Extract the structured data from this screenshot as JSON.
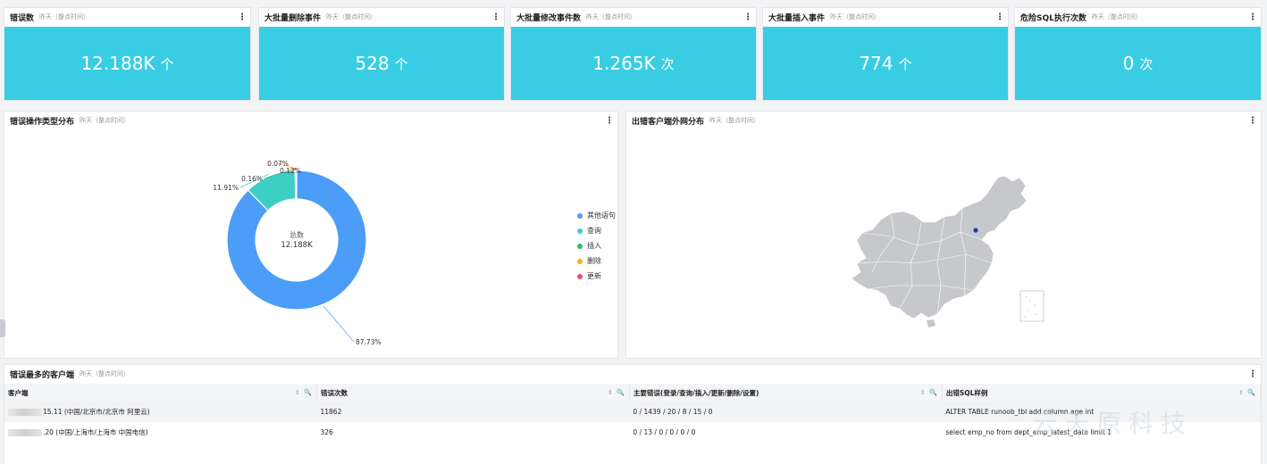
{
  "metrics": [
    {
      "title": "错误数",
      "subtitle": "昨天（整点时间）",
      "value": "12.188K",
      "unit": "个"
    },
    {
      "title": "大批量删除事件",
      "subtitle": "昨天（整点时间）",
      "value": "528",
      "unit": "个"
    },
    {
      "title": "大批量修改事件数",
      "subtitle": "昨天（整点时间）",
      "value": "1.265K",
      "unit": "次"
    },
    {
      "title": "大批量插入事件",
      "subtitle": "昨天（整点时间）",
      "value": "774",
      "unit": "个"
    },
    {
      "title": "危险SQL执行次数",
      "subtitle": "昨天（整点时间）",
      "value": "0",
      "unit": "次"
    }
  ],
  "menu_icon": "⋮",
  "pie_panel": {
    "title": "错误操作类型分布",
    "subtitle": "昨天（整点时间）",
    "center_label": "总数",
    "center_value": "12.188K"
  },
  "map_panel": {
    "title": "出错客户端外网分布",
    "subtitle": "昨天（整点时间）",
    "map_fill": "#c6c8cb",
    "marker_color": "#1f3f9e"
  },
  "chart_data": {
    "type": "pie",
    "slices": [
      {
        "name": "其他语句",
        "percent": 87.73,
        "label": "87.73%",
        "color": "#4b9df7"
      },
      {
        "name": "查询",
        "percent": 11.91,
        "label": "11.91%",
        "color": "#3ecfc4"
      },
      {
        "name": "插入",
        "percent": 0.16,
        "label": "0.16%",
        "color": "#2cbf5a"
      },
      {
        "name": "删除",
        "percent": 0.07,
        "label": "0.07%",
        "color": "#f6b11b"
      },
      {
        "name": "更新",
        "percent": 0.12,
        "label": "0.12%",
        "color": "#f04a6a"
      }
    ],
    "legend_position": "right"
  },
  "table_panel": {
    "title": "错误最多的客户端",
    "subtitle": "昨天（整点时间）",
    "sort_icon": "⇕ 🔍",
    "columns": [
      "客户端",
      "错误次数",
      "主要错误(登录/查询/插入/更新/删除/设置)",
      "出错SQL样例"
    ],
    "rows": [
      {
        "client": "15.11 (中国/北京市/北京市 阿里云)",
        "count": "11862",
        "errors": "0 / 1439 / 20 / 8 / 15 / 0",
        "sql": "ALTER TABLE runoob_tbl add column age int"
      },
      {
        "client": ".20 (中国/上海市/上海市 中国电信)",
        "count": "326",
        "errors": "0 / 13 / 0 / 0 / 0 / 0",
        "sql": "select emp_no from dept_emp_latest_date limit 1"
      }
    ]
  },
  "watermark": "云天原科技"
}
